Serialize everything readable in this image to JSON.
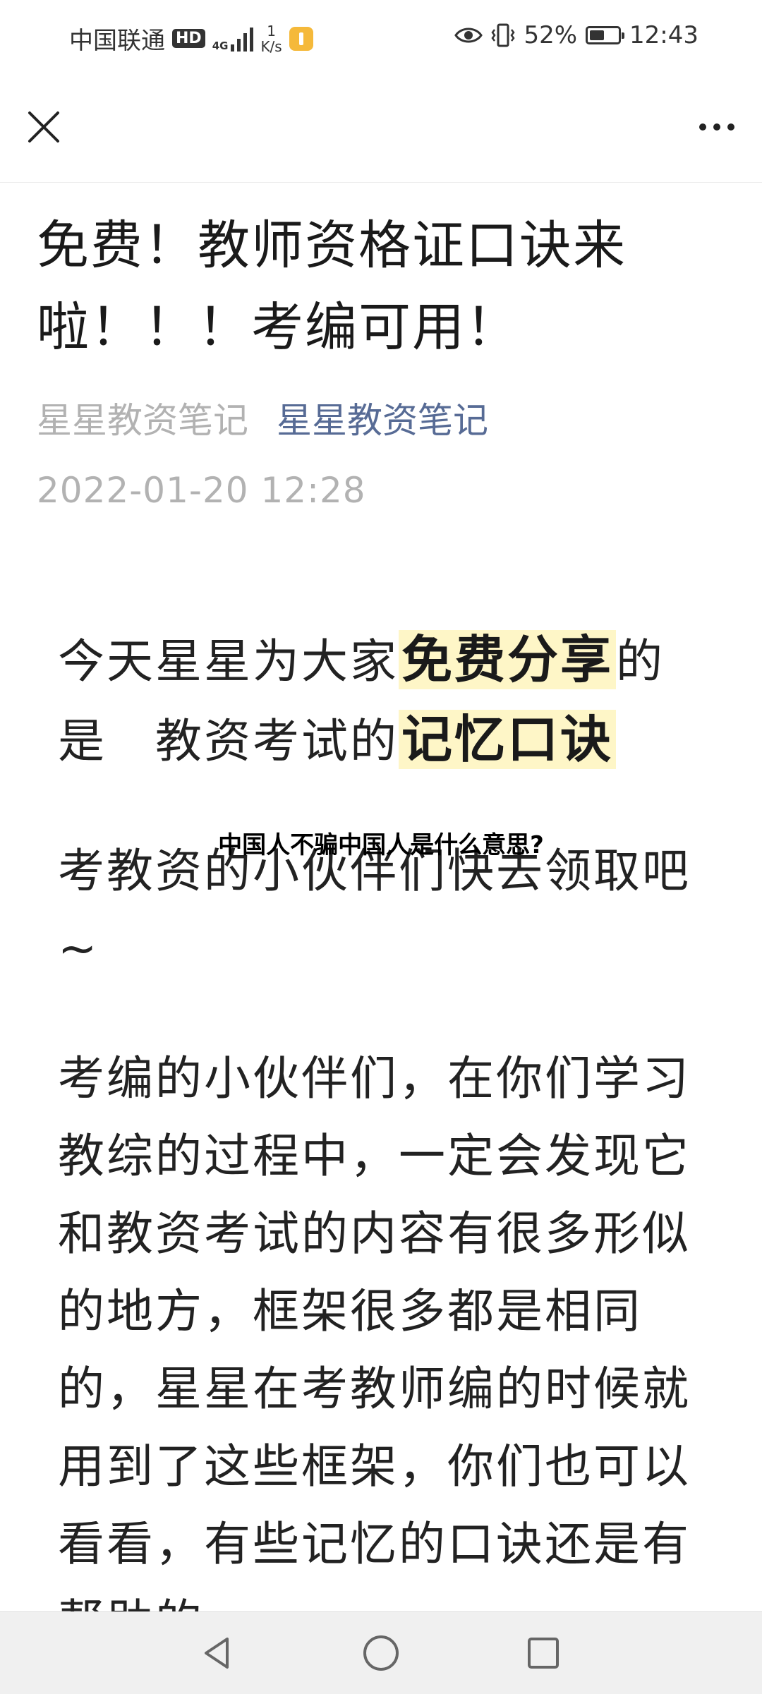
{
  "status_bar": {
    "carrier": "中国联通",
    "hd_badge": "HD",
    "network": "4G",
    "speed_value": "1",
    "speed_unit": "K/s",
    "battery": "52%",
    "time": "12:43",
    "battery_level": 0.52
  },
  "article": {
    "title": "免费！教师资格证口诀来啦！！！考编可用！",
    "author_1": "星星教资笔记",
    "author_2": "星星教资笔记",
    "date": "2022-01-20 12:28",
    "p1_a": "今天星星为大家",
    "p1_hl1": "免费分享",
    "p1_b": "的是　教资考试的",
    "p1_hl2": "记忆口诀",
    "p2": "考教资的小伙伴们快去领取吧~",
    "p3": "考编的小伙伴们，在你们学习教综的过程中，一定会发现它和教资考试的内容有很多形似的地方，框架很多都是相同的，星星在考教师编的时候就用到了这些框架，你们也可以看看，有些记忆的口诀还是有帮助的。",
    "overlay_question": "中国人不骗中国人是什么意思?"
  },
  "icons": {
    "close": "close-icon",
    "more": "more-icon",
    "back": "back-triangle-icon",
    "home": "home-circle-icon",
    "recent": "recent-square-icon"
  },
  "colors": {
    "author_link": "#576b95",
    "meta_gray": "#b2b2b2",
    "highlight": "#fef6c7"
  }
}
